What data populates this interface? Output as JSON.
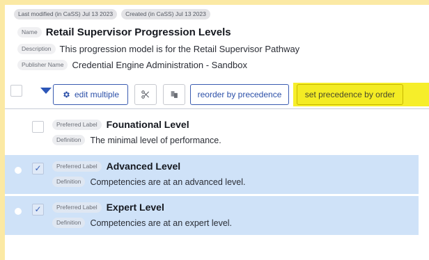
{
  "meta": {
    "last_modified": "Last modified (in CaSS) Jul 13 2023",
    "created": "Created (in CaSS) Jul 13 2023"
  },
  "fields": {
    "name_label": "Name",
    "name_value": "Retail Supervisor Progression Levels",
    "description_label": "Description",
    "description_value": "This progression model is for the Retail Supervisor Pathway",
    "publisher_label": "Publisher Name",
    "publisher_value": "Credential Engine Administration - Sandbox"
  },
  "toolbar": {
    "edit_multiple": "edit multiple",
    "reorder_by_precedence": "reorder by precedence",
    "set_precedence_by_order": "set precedence by order",
    "icons": [
      "caret-down-icon",
      "gear-icon",
      "scissors-icon",
      "paste-icon"
    ],
    "highlight_color": "#f4ec24"
  },
  "levels": [
    {
      "preferred_label_tag": "Preferred Label",
      "title": "Founational Level",
      "definition_tag": "Definition",
      "definition": "The minimal level of performance.",
      "selected": false
    },
    {
      "preferred_label_tag": "Preferred Label",
      "title": "Advanced Level",
      "definition_tag": "Definition",
      "definition": "Competencies are at an advanced level.",
      "selected": true
    },
    {
      "preferred_label_tag": "Preferred Label",
      "title": "Expert Level",
      "definition_tag": "Definition",
      "definition": "Competencies are at an expert level.",
      "selected": true
    }
  ],
  "colors": {
    "accent": "#2b4fa8",
    "selected_row": "#cfe2f8",
    "frame": "#fbe9a4"
  }
}
